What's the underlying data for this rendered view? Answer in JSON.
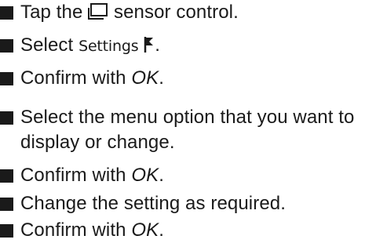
{
  "steps": [
    {
      "before": "Tap the ",
      "after": " sensor control.",
      "icon": "sensor-icon"
    },
    {
      "before": "Select ",
      "term": "Settings",
      "after": ".",
      "icon": "flag-icon"
    },
    {
      "before": "Confirm with ",
      "em": "OK",
      "after": "."
    },
    {
      "text": "Select the menu option that you want to display or change."
    },
    {
      "before": "Confirm with ",
      "em": "OK",
      "after": "."
    },
    {
      "text": "Change the setting as required."
    },
    {
      "before": "Confirm with ",
      "em": "OK",
      "after": "."
    }
  ]
}
